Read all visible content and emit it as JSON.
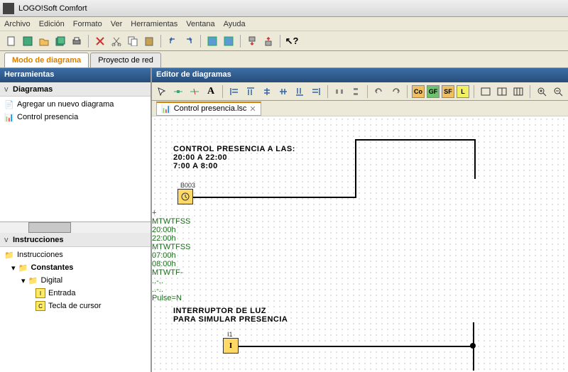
{
  "window": {
    "title": "LOGO!Soft Comfort"
  },
  "menu": [
    "Archivo",
    "Edición",
    "Formato",
    "Ver",
    "Herramientas",
    "Ventana",
    "Ayuda"
  ],
  "tabs": {
    "active": "Modo de diagrama",
    "other": "Proyecto de red"
  },
  "left": {
    "tools_header": "Herramientas",
    "diagrams_header": "Diagramas",
    "add_new": "Agregar un nuevo diagrama",
    "diagram_item": "Control presencia",
    "instructions_header": "Instrucciones",
    "tree": {
      "root": "Instrucciones",
      "constants": "Constantes",
      "digital": "Digital",
      "entrada": "Entrada",
      "tecla": "Tecla de cursor"
    }
  },
  "editor": {
    "header": "Editor de diagramas",
    "file_tab": "Control presencia.lsc",
    "buttons": {
      "co": "Co",
      "gf": "GF",
      "sf": "SF",
      "l": "L"
    }
  },
  "canvas": {
    "title1_l1": "CONTROL PRESENCIA A LAS:",
    "title1_l2": "20:00 A 22:00",
    "title1_l3": "7:00 A 8:00",
    "block1_label": "B003",
    "params": [
      "+",
      "MTWTFSS",
      "20:00h",
      "22:00h",
      "MTWTFSS",
      "07:00h",
      "08:00h",
      "MTWTF-",
      "..-..",
      "..-..",
      "Pulse=N"
    ],
    "title2_l1": "INTERRUPTOR DE LUZ",
    "title2_l2": "PARA SIMULAR PRESENCIA",
    "block2_label": "I1",
    "block2_text": "I"
  }
}
